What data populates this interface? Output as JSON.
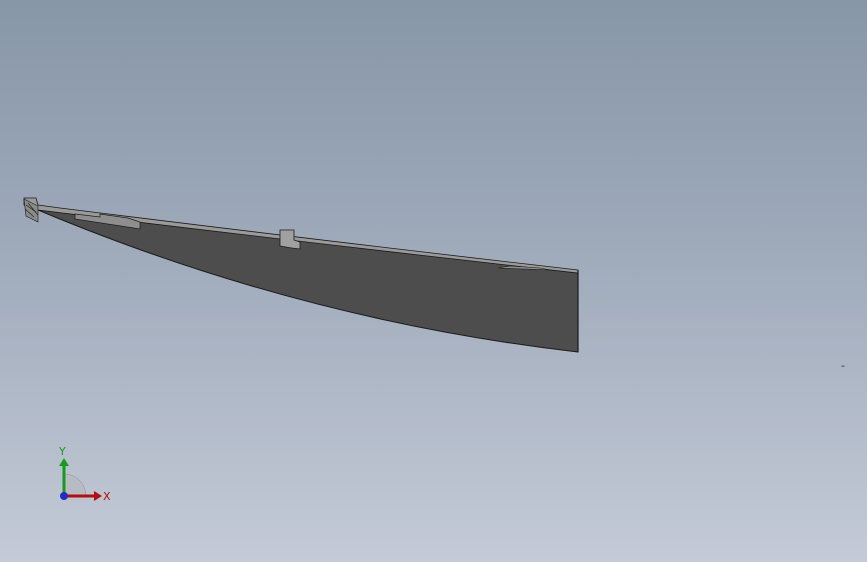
{
  "viewport": {
    "background_top": "#8796a8",
    "background_bottom": "#c4cbd7"
  },
  "model": {
    "part_name": "curved-beam",
    "body_color": "#4d4d4d",
    "top_face_color": "#9a9a9a",
    "edge_color": "#1a1a1a"
  },
  "triad": {
    "x_label": "X",
    "y_label": "Y",
    "x_color": "#b01010",
    "y_color": "#1a9a1a",
    "z_color": "#2030c0"
  },
  "status": {
    "corner_mark": "-"
  }
}
